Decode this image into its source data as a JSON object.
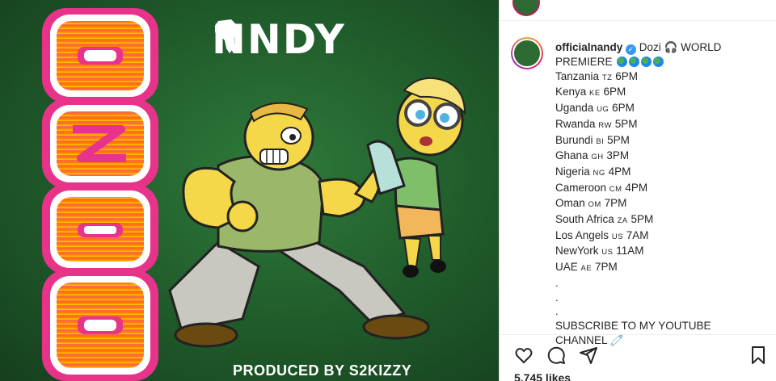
{
  "artwork": {
    "brand_text_left": "N",
    "brand_text_right": "NDY",
    "title_vertical": "DOZI",
    "produced_prefix": "PRODUCED BY",
    "produced_name": "S2KIZZY"
  },
  "post": {
    "username": "officialnandy",
    "verified_glyph": "✓",
    "caption_first": "Dozi 🎧 WORLD",
    "caption_second": "PREMIERE",
    "schedule": [
      {
        "country": "Tanzania",
        "code": "TZ",
        "time": "6PM"
      },
      {
        "country": "Kenya",
        "code": "KE",
        "time": "6PM"
      },
      {
        "country": "Uganda",
        "code": "UG",
        "time": "6PM"
      },
      {
        "country": "Rwanda",
        "code": "RW",
        "time": "5PM"
      },
      {
        "country": "Burundi",
        "code": "BI",
        "time": "5PM"
      },
      {
        "country": "Ghana",
        "code": "GH",
        "time": "3PM"
      },
      {
        "country": "Nigeria",
        "code": "NG",
        "time": "4PM"
      },
      {
        "country": "Cameroon",
        "code": "CM",
        "time": "4PM"
      },
      {
        "country": "Oman",
        "code": "OM",
        "time": "7PM"
      },
      {
        "country": "South Africa",
        "code": "ZA",
        "time": "5PM"
      },
      {
        "country": "Los Angels",
        "code": "US",
        "time": "7AM"
      },
      {
        "country": "NewYork",
        "code": "US",
        "time": "11AM"
      },
      {
        "country": "UAE",
        "code": "AE",
        "time": "7PM"
      }
    ],
    "dots": [
      ".",
      ".",
      "."
    ],
    "subscribe_line1": "SUBSCRIBE TO MY YOUTUBE",
    "subscribe_line2": "CHANNEL",
    "subscribe_emoji": "🧷",
    "likes": "5,745 likes"
  },
  "icons": {
    "like": "heart-icon",
    "comment": "comment-icon",
    "share": "share-icon",
    "save": "bookmark-icon",
    "globe": "globe-icon",
    "verified": "verified-badge-icon"
  },
  "colors": {
    "art_bg": "#1f5a2a",
    "title_pink": "#e8338a",
    "title_orange": "#ff8a00",
    "verified_blue": "#3897f0",
    "text": "#262626"
  }
}
